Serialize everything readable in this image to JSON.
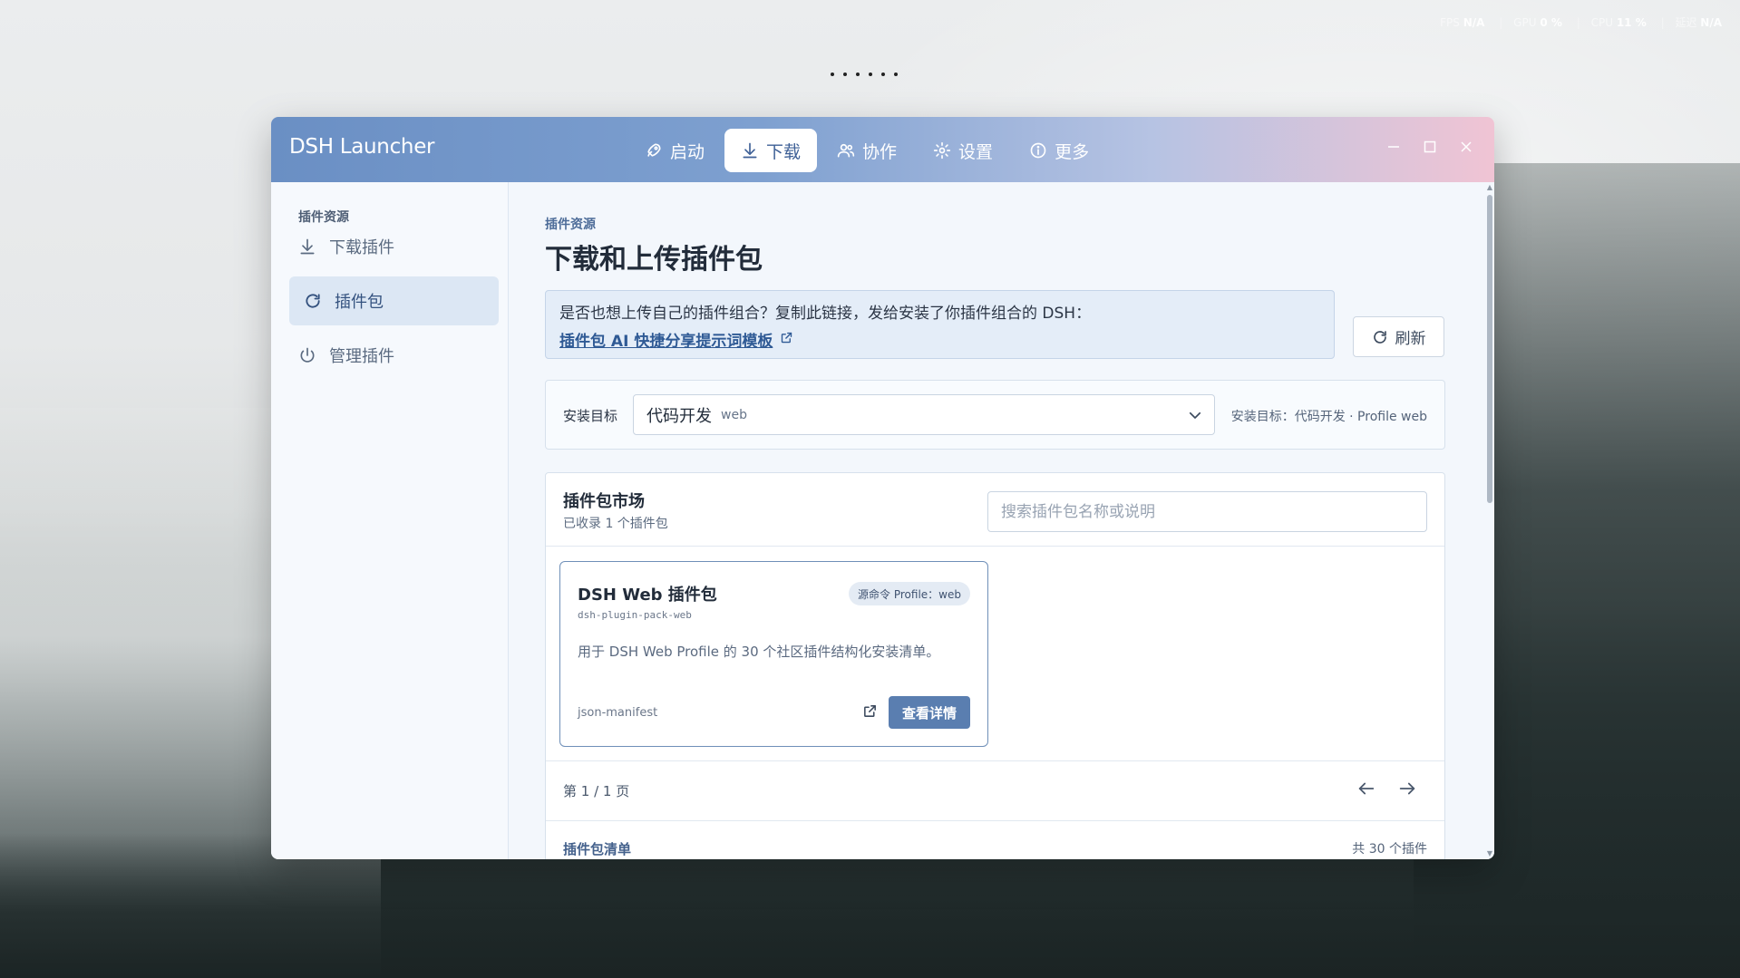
{
  "perf": {
    "fps_label": "FPS",
    "fps_value": "N/A",
    "gpu_label": "GPU",
    "gpu_value": "0 %",
    "cpu_label": "CPU",
    "cpu_value": "11 %",
    "latency_label": "延迟",
    "latency_value": "N/A"
  },
  "app": {
    "title": "DSH Launcher"
  },
  "nav": {
    "launch": "启动",
    "download": "下载",
    "collab": "协作",
    "settings": "设置",
    "more": "更多"
  },
  "sidebar": {
    "section": "插件资源",
    "items": [
      {
        "label": "下载插件",
        "icon": "download-icon"
      },
      {
        "label": "插件包",
        "icon": "refresh-icon",
        "active": true
      },
      {
        "label": "管理插件",
        "icon": "power-icon"
      }
    ]
  },
  "main": {
    "breadcrumb": "插件资源",
    "title": "下载和上传插件包",
    "notice": {
      "text": "是否也想上传自己的插件组合？复制此链接，发给安装了你插件组合的 DSH：",
      "link": "插件包 AI 快捷分享提示词模板"
    },
    "refresh_label": "刷新",
    "install_target": {
      "label": "安装目标",
      "selected": "代码开发",
      "selected_sub": "web",
      "summary": "安装目标：代码开发 · Profile web"
    },
    "market": {
      "title": "插件包市场",
      "count": "已收录 1 个插件包",
      "search_placeholder": "搜索插件包名称或说明",
      "packs": [
        {
          "name": "DSH Web 插件包",
          "id": "dsh-plugin-pack-web",
          "badge": "源命令 Profile：web",
          "description": "用于 DSH Web Profile 的 30 个社区插件结构化安装清单。",
          "format": "json-manifest",
          "detail_label": "查看详情"
        }
      ],
      "page_info": "第 1 / 1 页",
      "list_title": "插件包清单",
      "list_count": "共 30 个插件"
    }
  },
  "colors": {
    "accent": "#5a7eb0",
    "title_gradient_start": "#6a8fc4",
    "title_gradient_end": "#f0c4d4"
  }
}
